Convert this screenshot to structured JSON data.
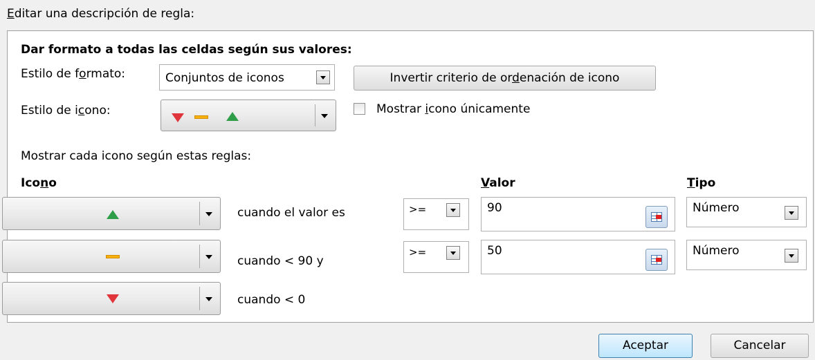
{
  "section_title": {
    "pre": "",
    "mnemonic": "E",
    "post": "ditar una descripción de regla:"
  },
  "format_heading": "Dar formato a todas las celdas según sus valores:",
  "format_style": {
    "label": {
      "pre": "Estilo de f",
      "mnemonic": "o",
      "post": "rmato:"
    },
    "value": "Conjuntos de iconos"
  },
  "reverse_button": {
    "pre": "Invertir criterio de or",
    "mnemonic": "d",
    "post": "enación de icono"
  },
  "icon_style": {
    "label": {
      "pre": "Estilo de i",
      "mnemonic": "c",
      "post": "ono:"
    },
    "icons": [
      "red-down-triangle-icon",
      "yellow-dash-icon",
      "green-up-triangle-icon"
    ]
  },
  "show_icon_only": {
    "checked": false,
    "label": {
      "pre": "Mostrar ",
      "mnemonic": "i",
      "post": "cono únicamente"
    }
  },
  "rules_heading": "Mostrar cada icono según estas reglas:",
  "columns": {
    "icon": {
      "pre": "Ico",
      "mnemonic": "n",
      "post": "o"
    },
    "value": {
      "pre": "",
      "mnemonic": "V",
      "post": "alor"
    },
    "type": {
      "pre": "",
      "mnemonic": "T",
      "post": "ipo"
    }
  },
  "rules": [
    {
      "icon": "green-up-triangle-icon",
      "condition": "cuando el valor es",
      "operator": ">=",
      "value": "90",
      "type": "Número"
    },
    {
      "icon": "yellow-dash-icon",
      "condition": "cuando < 90 y",
      "operator": ">=",
      "value": "50",
      "type": "Número"
    },
    {
      "icon": "red-down-triangle-icon",
      "condition": "cuando < 0"
    }
  ],
  "buttons": {
    "ok": "Aceptar",
    "cancel": "Cancelar"
  },
  "colors": {
    "up": "#2f9e48",
    "neutral": "#f6b10c",
    "down": "#e0353a"
  }
}
